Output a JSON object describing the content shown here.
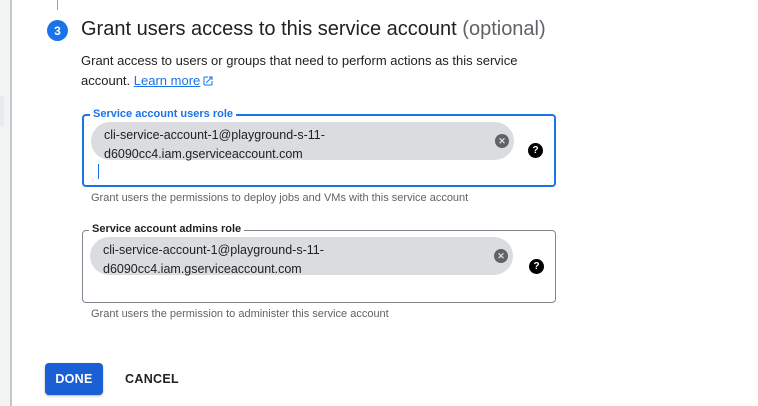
{
  "step": {
    "number": "3",
    "title": "Grant users access to this service account",
    "optional": "(optional)",
    "description": "Grant access to users or groups that need to perform actions as this service account.",
    "learn_more": "Learn more"
  },
  "users_role": {
    "label": "Service account users role",
    "chip_line1": "cli-service-account-1@playground-s-11-",
    "chip_line2": "d6090cc4.iam.gserviceaccount.com",
    "hint": "Grant users the permissions to deploy jobs and VMs with this service account"
  },
  "admins_role": {
    "label": "Service account admins role",
    "chip_line1": "cli-service-account-1@playground-s-11-",
    "chip_line2": "d6090cc4.iam.gserviceaccount.com",
    "hint": "Grant users the permission to administer this service account"
  },
  "icons": {
    "chip_remove": "close-circle-icon",
    "help": "help-icon",
    "external_link": "open-in-new-icon"
  },
  "colors": {
    "accent": "#1a73e8",
    "primary_button": "#1a5fd4"
  },
  "actions": {
    "done": "DONE",
    "cancel": "CANCEL"
  }
}
